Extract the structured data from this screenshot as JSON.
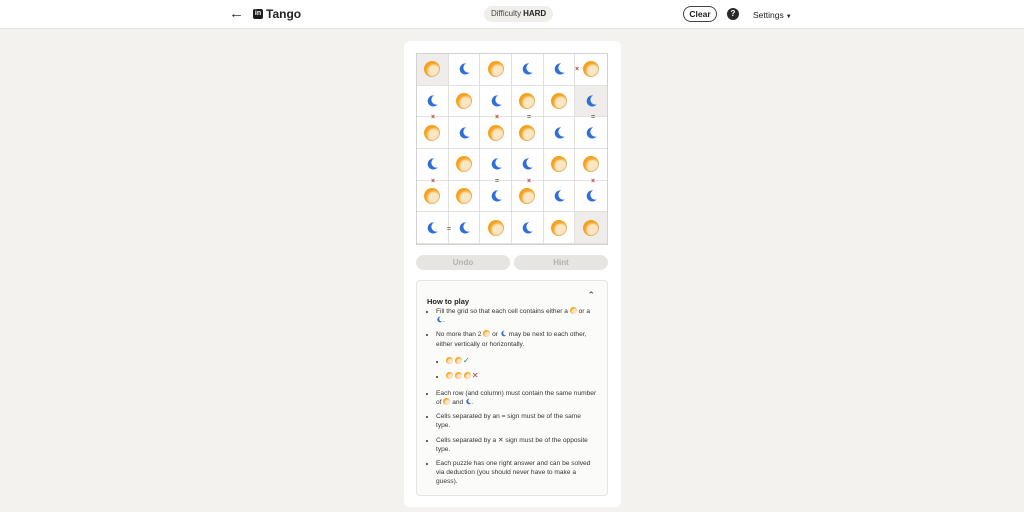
{
  "header": {
    "back_icon": "arrow-left-icon",
    "logo_text": "in",
    "title": "Tango",
    "difficulty_label": "Difficulty",
    "difficulty_value": "HARD",
    "clear_label": "Clear",
    "help_label": "?",
    "settings_label": "Settings"
  },
  "board": {
    "rows": [
      [
        "sun",
        "moon",
        "sun",
        "moon",
        "moon",
        "sun"
      ],
      [
        "moon",
        "sun",
        "moon",
        "sun",
        "sun",
        "moon"
      ],
      [
        "sun",
        "moon",
        "sun",
        "sun",
        "moon",
        "moon"
      ],
      [
        "moon",
        "sun",
        "moon",
        "moon",
        "sun",
        "sun"
      ],
      [
        "sun",
        "sun",
        "moon",
        "sun",
        "moon",
        "moon"
      ],
      [
        "moon",
        "moon",
        "sun",
        "moon",
        "sun",
        "sun"
      ]
    ],
    "locked": [
      [
        0,
        0
      ],
      [
        1,
        5
      ],
      [
        5,
        5
      ]
    ],
    "signs": [
      {
        "type": "x",
        "between": [
          [
            0,
            4
          ],
          [
            0,
            5
          ]
        ]
      },
      {
        "type": "x",
        "between": [
          [
            1,
            0
          ],
          [
            2,
            0
          ]
        ]
      },
      {
        "type": "x",
        "between": [
          [
            1,
            2
          ],
          [
            2,
            2
          ]
        ]
      },
      {
        "type": "=",
        "between": [
          [
            1,
            3
          ],
          [
            2,
            3
          ]
        ]
      },
      {
        "type": "=",
        "between": [
          [
            1,
            5
          ],
          [
            2,
            5
          ]
        ]
      },
      {
        "type": "x",
        "between": [
          [
            3,
            0
          ],
          [
            4,
            0
          ]
        ]
      },
      {
        "type": "=",
        "between": [
          [
            3,
            2
          ],
          [
            4,
            2
          ]
        ]
      },
      {
        "type": "x",
        "between": [
          [
            3,
            3
          ],
          [
            4,
            3
          ]
        ]
      },
      {
        "type": "x",
        "between": [
          [
            3,
            5
          ],
          [
            4,
            5
          ]
        ]
      },
      {
        "type": "=",
        "between": [
          [
            5,
            0
          ],
          [
            5,
            1
          ]
        ]
      }
    ],
    "sign_glyphs": {
      "x": "×",
      "=": "="
    }
  },
  "actions": {
    "undo_label": "Undo",
    "hint_label": "Hint"
  },
  "howto": {
    "title": "How to play",
    "toggle_icon": "chevron-up-icon",
    "rule1_a": "Fill the grid so that each cell contains either a",
    "rule1_b": "or a",
    "rule1_c": ".",
    "rule2_a": "No more than 2",
    "rule2_b": "or",
    "rule2_c": "may be next to each other, either vertically or horizontally.",
    "example_ok": "✓",
    "example_bad": "✕",
    "rule3_a": "Each row (and column) must contain the same number of",
    "rule3_b": "and",
    "rule3_c": ".",
    "rule4": "Cells separated by an = sign must be of the same type.",
    "rule5_a": "Cells separated by a",
    "rule5_x": "✕",
    "rule5_b": "sign must be of the opposite type.",
    "rule6": "Each puzzle has one right answer and can be solved via deduction (you should never have to make a guess)."
  },
  "colors": {
    "sun": "#f5a623",
    "moon": "#2f6fd6",
    "locked_cell": "#eeedeb"
  }
}
